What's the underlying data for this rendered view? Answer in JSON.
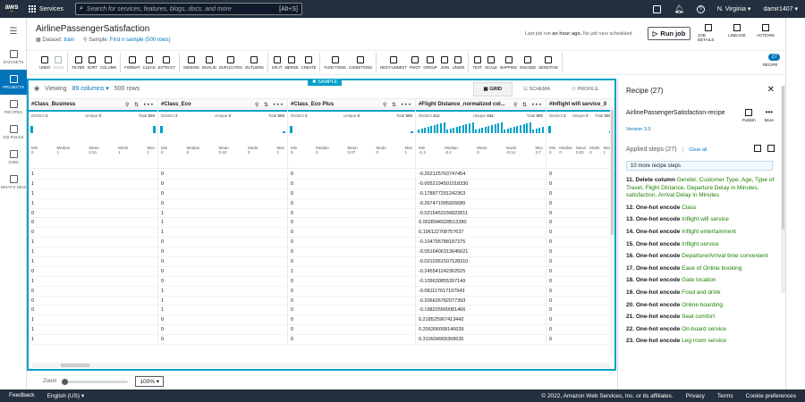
{
  "topbar": {
    "logo": "aws",
    "services": "Services",
    "search_placeholder": "Search for services, features, blogs, docs, and more",
    "shortcut": "[Alt+S]",
    "region": "N. Virginia",
    "user": "damir1407"
  },
  "leftnav": [
    {
      "label": "DATASETS",
      "icon": "datasets-icon",
      "active": false
    },
    {
      "label": "PROJECTS",
      "icon": "projects-icon",
      "active": true
    },
    {
      "label": "RECIPES",
      "icon": "recipes-icon",
      "active": false
    },
    {
      "label": "DQ RULES",
      "icon": "dq-rules-icon",
      "active": false
    },
    {
      "label": "JOBS",
      "icon": "jobs-icon",
      "active": false
    },
    {
      "label": "WHAT'S NEW",
      "icon": "whats-new-icon",
      "active": false
    }
  ],
  "header": {
    "title": "AirlinePassengerSatisfaction",
    "dataset_label": "Dataset:",
    "dataset_value": "train",
    "sample_label": "Sample:",
    "sample_value": "First n sample (500 rows)",
    "last_job_prefix": "Last job run",
    "last_job_time": "an hour ago.",
    "last_job_suffix": "No job runs scheduled",
    "run_job": "Run job",
    "job_details": "JOB DETAILS",
    "lineage": "LINEAGE",
    "actions": "ACTIONS"
  },
  "toolbar": {
    "groups": [
      [
        {
          "label": "UNDO",
          "icon": "undo-icon",
          "disabled": false
        },
        {
          "label": "REDO",
          "icon": "redo-icon",
          "disabled": true
        }
      ],
      [
        {
          "label": "FILTER",
          "icon": "filter-icon"
        },
        {
          "label": "SORT",
          "icon": "sort-icon"
        },
        {
          "label": "COLUMN",
          "icon": "column-icon"
        }
      ],
      [
        {
          "label": "FORMAT",
          "icon": "format-icon"
        },
        {
          "label": "CLEAN",
          "icon": "clean-icon"
        },
        {
          "label": "EXTRACT",
          "icon": "extract-icon"
        }
      ],
      [
        {
          "label": "MISSING",
          "icon": "missing-icon"
        },
        {
          "label": "INVALID",
          "icon": "invalid-icon"
        },
        {
          "label": "DUPLICATES",
          "icon": "duplicates-icon"
        },
        {
          "label": "OUTLIERS",
          "icon": "outliers-icon"
        }
      ],
      [
        {
          "label": "SPLIT",
          "icon": "split-icon"
        },
        {
          "label": "MERGE",
          "icon": "merge-icon"
        },
        {
          "label": "CREATE",
          "icon": "create-icon"
        }
      ],
      [
        {
          "label": "FUNCTIONS",
          "icon": "functions-icon"
        },
        {
          "label": "CONDITIONS",
          "icon": "conditions-icon"
        }
      ],
      [
        {
          "label": "NEST-UNNEST",
          "icon": "nest-unnest-icon"
        },
        {
          "label": "PIVOT",
          "icon": "pivot-icon"
        },
        {
          "label": "GROUP",
          "icon": "group-icon"
        },
        {
          "label": "JOIN",
          "icon": "join-icon"
        },
        {
          "label": "UNION",
          "icon": "union-icon"
        }
      ],
      [
        {
          "label": "TEXT",
          "icon": "text-icon"
        },
        {
          "label": "SCALE",
          "icon": "scale-icon"
        },
        {
          "label": "MAPPING",
          "icon": "mapping-icon"
        },
        {
          "label": "ENCODE",
          "icon": "encode-icon"
        },
        {
          "label": "SENSITIVE",
          "icon": "sensitive-icon"
        }
      ]
    ],
    "recipe_label": "RECIPE",
    "recipe_count": "27"
  },
  "grid": {
    "sample_tag": "SAMPLE",
    "viewing": "Viewing",
    "columns": "89 columns",
    "rows": "500 rows",
    "view_tabs": [
      "GRID",
      "SCHEMA",
      "PROFILE"
    ],
    "columns_def": [
      {
        "name": "Class_Business",
        "distinct": "2",
        "unique": "0",
        "total": "500",
        "min": "0",
        "median": "1",
        "mean": "0.51",
        "mode": "1",
        "max": "1"
      },
      {
        "name": "Class_Eco",
        "distinct": "2",
        "unique": "0",
        "total": "500",
        "min": "0",
        "median": "0",
        "mean": "0.42",
        "mode": "0",
        "max": "1"
      },
      {
        "name": "Class_Eco Plus",
        "distinct": "2",
        "unique": "0",
        "total": "500",
        "min": "0",
        "median": "0",
        "mean": "0.07",
        "mode": "0",
        "max": "1"
      },
      {
        "name": "Flight Distance_normalized col...",
        "distinct": "412",
        "unique": "344",
        "total": "500",
        "min": "-1.3",
        "median": "-0.1",
        "mean": "0",
        "mode": "-0.14",
        "max": "3.7"
      },
      {
        "name": "Inflight wifi service_0",
        "distinct": "2",
        "unique": "0",
        "total": "500",
        "min": "0",
        "median": "0",
        "mean": "0.03",
        "mode": "0",
        "max": "1"
      }
    ],
    "rows_data": [
      [
        "1",
        "0",
        "0",
        "-0.262125763747454",
        "0"
      ],
      [
        "1",
        "0",
        "0",
        "-0.0052194501018330",
        "0"
      ],
      [
        "1",
        "0",
        "0",
        "-0.178877291242363",
        "0"
      ],
      [
        "1",
        "0",
        "0",
        "-0.267471995926680",
        "0"
      ],
      [
        "0",
        "1",
        "0",
        "-0.0215453156822811",
        "0"
      ],
      [
        "0",
        "1",
        "0",
        "0.0028946028513280",
        "0"
      ],
      [
        "0",
        "1",
        "0",
        "0.196122708757637",
        "0"
      ],
      [
        "1",
        "0",
        "0",
        "-0.104795788187375",
        "0"
      ],
      [
        "1",
        "0",
        "0",
        "-0.0516406313645621",
        "0"
      ],
      [
        "1",
        "0",
        "0",
        "-0.0210361507128310",
        "0"
      ],
      [
        "0",
        "0",
        "1",
        "-0.245541242362525",
        "0"
      ],
      [
        "1",
        "0",
        "0",
        "-0.109630855397149",
        "0"
      ],
      [
        "0",
        "1",
        "0",
        "-0.081117617107943",
        "0"
      ],
      [
        "0",
        "1",
        "0",
        "-0.206626782077393",
        "0"
      ],
      [
        "0",
        "1",
        "0",
        "-0.198225560081466",
        "0"
      ],
      [
        "1",
        "0",
        "0",
        "0.218525967413442",
        "0"
      ],
      [
        "1",
        "0",
        "0",
        "0.206306008146639",
        "0"
      ],
      [
        "1",
        "0",
        "0",
        "0.310934909368635",
        "0"
      ]
    ]
  },
  "zoom": {
    "label": "Zoom",
    "value": "100%",
    "level": 0.0
  },
  "recipe": {
    "title": "Recipe (27)",
    "name": "AirlinePassengerSatisfaction-recipe",
    "version": "Version 3.0",
    "publish": "Publish",
    "more": "More",
    "applied": "Applied steps (27)",
    "clear_all": "Clear all",
    "more_steps": "10 more recipe steps",
    "steps": [
      {
        "num": "11.",
        "action": "Delete column",
        "target": "Gender, Customer Type, Age, Type of Travel, Flight Distance, Departure Delay in Minutes, satisfaction, Arrival Delay in Minutes"
      },
      {
        "num": "12.",
        "action": "One-hot encode",
        "target": "Class"
      },
      {
        "num": "13.",
        "action": "One-hot encode",
        "target": "Inflight wifi service"
      },
      {
        "num": "14.",
        "action": "One-hot encode",
        "target": "Inflight entertainment"
      },
      {
        "num": "15.",
        "action": "One-hot encode",
        "target": "Inflight service"
      },
      {
        "num": "16.",
        "action": "One-hot encode",
        "target": "Departure/Arrival time convenient"
      },
      {
        "num": "17.",
        "action": "One-hot encode",
        "target": "Ease of Online booking"
      },
      {
        "num": "18.",
        "action": "One-hot encode",
        "target": "Gate location"
      },
      {
        "num": "19.",
        "action": "One-hot encode",
        "target": "Food and drink"
      },
      {
        "num": "20.",
        "action": "One-hot encode",
        "target": "Online boarding"
      },
      {
        "num": "21.",
        "action": "One-hot encode",
        "target": "Seat comfort"
      },
      {
        "num": "22.",
        "action": "One-hot encode",
        "target": "On-board service"
      },
      {
        "num": "23.",
        "action": "One-hot encode",
        "target": "Leg room service"
      }
    ]
  },
  "footer": {
    "feedback": "Feedback",
    "language": "English (US)",
    "copyright": "© 2022, Amazon Web Services, Inc. or its affiliates.",
    "privacy": "Privacy",
    "terms": "Terms",
    "cookies": "Cookie preferences"
  }
}
